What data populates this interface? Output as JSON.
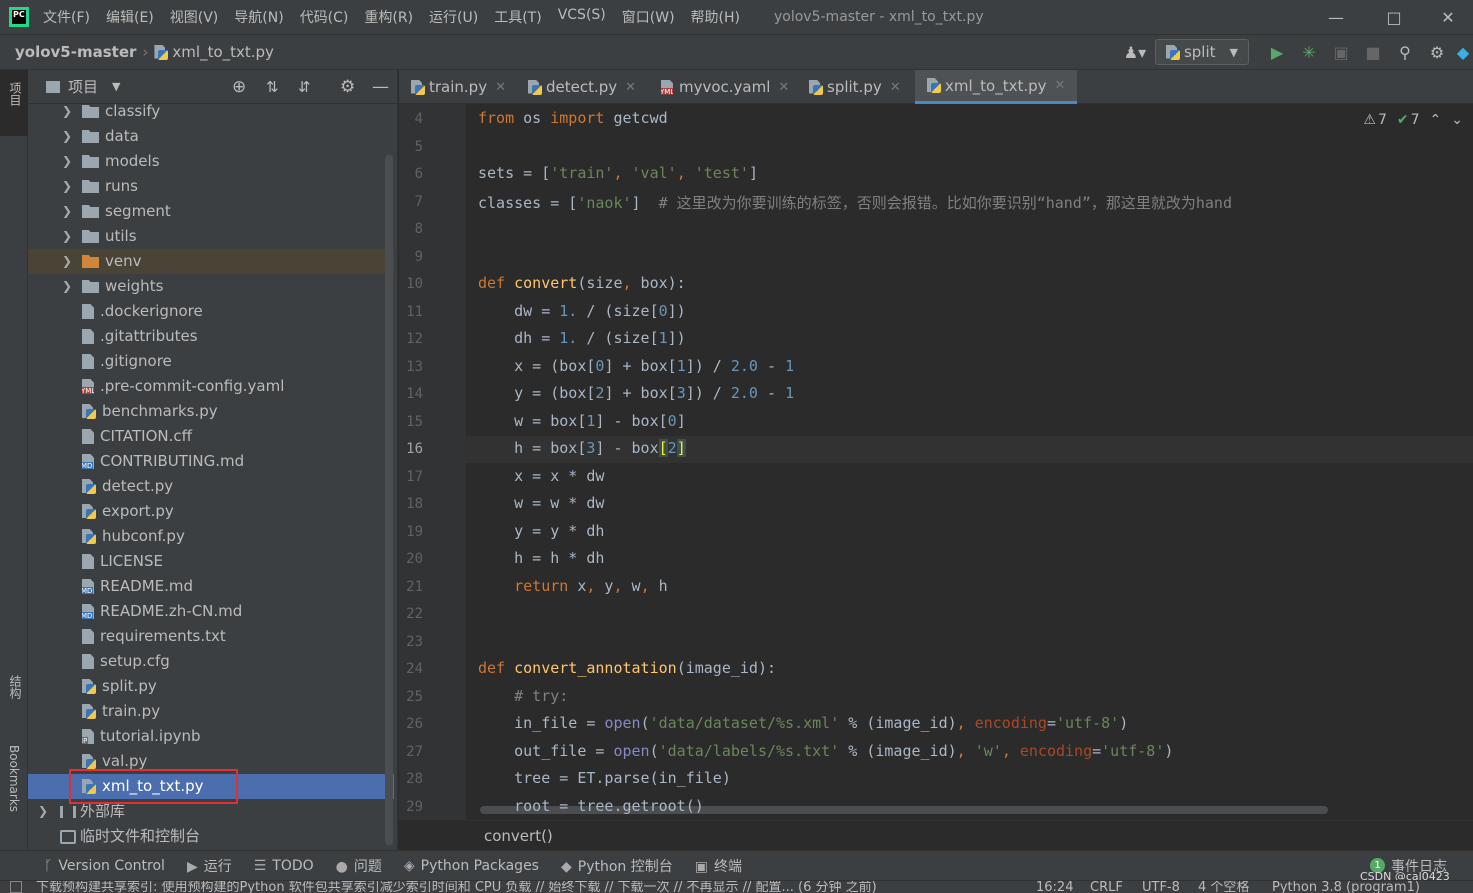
{
  "window": {
    "title": "yolov5-master - xml_to_txt.py"
  },
  "menu": [
    "文件(F)",
    "编辑(E)",
    "视图(V)",
    "导航(N)",
    "代码(C)",
    "重构(R)",
    "运行(U)",
    "工具(T)",
    "VCS(S)",
    "窗口(W)",
    "帮助(H)"
  ],
  "navbar": {
    "project": "yolov5-master",
    "file": "xml_to_txt.py",
    "run_config": "split"
  },
  "left_strip": {
    "project": "项目",
    "structure": "结构",
    "bookmarks": "Bookmarks"
  },
  "project_panel": {
    "title": "项目",
    "tree": [
      {
        "name": "classify",
        "type": "folder"
      },
      {
        "name": "data",
        "type": "folder"
      },
      {
        "name": "models",
        "type": "folder"
      },
      {
        "name": "runs",
        "type": "folder"
      },
      {
        "name": "segment",
        "type": "folder"
      },
      {
        "name": "utils",
        "type": "folder"
      },
      {
        "name": "venv",
        "type": "folder-orange"
      },
      {
        "name": "weights",
        "type": "folder"
      },
      {
        "name": ".dockerignore",
        "type": "file"
      },
      {
        "name": ".gitattributes",
        "type": "file"
      },
      {
        "name": ".gitignore",
        "type": "file"
      },
      {
        "name": ".pre-commit-config.yaml",
        "type": "yaml"
      },
      {
        "name": "benchmarks.py",
        "type": "py"
      },
      {
        "name": "CITATION.cff",
        "type": "file"
      },
      {
        "name": "CONTRIBUTING.md",
        "type": "md"
      },
      {
        "name": "detect.py",
        "type": "py"
      },
      {
        "name": "export.py",
        "type": "py"
      },
      {
        "name": "hubconf.py",
        "type": "py"
      },
      {
        "name": "LICENSE",
        "type": "file"
      },
      {
        "name": "README.md",
        "type": "md"
      },
      {
        "name": "README.zh-CN.md",
        "type": "md"
      },
      {
        "name": "requirements.txt",
        "type": "file"
      },
      {
        "name": "setup.cfg",
        "type": "file"
      },
      {
        "name": "split.py",
        "type": "py"
      },
      {
        "name": "train.py",
        "type": "py"
      },
      {
        "name": "tutorial.ipynb",
        "type": "ipynb"
      },
      {
        "name": "val.py",
        "type": "py"
      },
      {
        "name": "xml_to_txt.py",
        "type": "py"
      }
    ],
    "external_libs": "外部库",
    "scratches": "临时文件和控制台"
  },
  "editor_tabs": [
    {
      "label": "train.py",
      "type": "py"
    },
    {
      "label": "detect.py",
      "type": "py"
    },
    {
      "label": "myvoc.yaml",
      "type": "yaml"
    },
    {
      "label": "split.py",
      "type": "py"
    },
    {
      "label": "xml_to_txt.py",
      "type": "py",
      "active": true
    }
  ],
  "inspections": {
    "warnings": "7",
    "ok": "7"
  },
  "code": {
    "current_line": "16",
    "lines": [
      {
        "n": "4",
        "html": "<span class='kw'>from</span> os <span class='kw'>import</span> getcwd"
      },
      {
        "n": "5",
        "html": ""
      },
      {
        "n": "6",
        "html": "sets = [<span class='str'>'train'</span><span class='kw'>,</span> <span class='str'>'val'</span><span class='kw'>,</span> <span class='str'>'test'</span>]"
      },
      {
        "n": "7",
        "html": "classes = [<span class='str'>'naok'</span>]  <span class='cm'># 这里改为你要训练的标签，否则会报错。比如你要识别“hand”，那这里就改为hand</span>"
      },
      {
        "n": "8",
        "html": ""
      },
      {
        "n": "9",
        "html": ""
      },
      {
        "n": "10",
        "html": "<span class='kw'>def</span> <span class='fn'>convert</span>(size<span class='kw'>,</span> box):"
      },
      {
        "n": "11",
        "html": "    dw = <span class='num'>1.</span> / (size[<span class='num'>0</span>])"
      },
      {
        "n": "12",
        "html": "    dh = <span class='num'>1.</span> / (size[<span class='num'>1</span>])"
      },
      {
        "n": "13",
        "html": "    x = (box[<span class='num'>0</span>] + box[<span class='num'>1</span>]) / <span class='num'>2.0</span> - <span class='num'>1</span>"
      },
      {
        "n": "14",
        "html": "    y = (box[<span class='num'>2</span>] + box[<span class='num'>3</span>]) / <span class='num'>2.0</span> - <span class='num'>1</span>"
      },
      {
        "n": "15",
        "html": "    w = box[<span class='num'>1</span>] - box[<span class='num'>0</span>]"
      },
      {
        "n": "16",
        "html": "    h = box[<span class='num'>3</span>] - box<span style='color:#ffef28;background:#3b514d'>[</span><span class='num'>2</span><span style='color:#ffef28;background:#3b514d'>]</span>"
      },
      {
        "n": "17",
        "html": "    x = x * dw"
      },
      {
        "n": "18",
        "html": "    w = w * dw"
      },
      {
        "n": "19",
        "html": "    y = y * dh"
      },
      {
        "n": "20",
        "html": "    h = h * dh"
      },
      {
        "n": "21",
        "html": "    <span class='kw'>return</span> x<span class='kw'>,</span> y<span class='kw'>,</span> w<span class='kw'>,</span> h"
      },
      {
        "n": "22",
        "html": ""
      },
      {
        "n": "23",
        "html": ""
      },
      {
        "n": "24",
        "html": "<span class='kw'>def</span> <span class='fn'>convert_annotation</span>(image_id):"
      },
      {
        "n": "25",
        "html": "    <span class='cm'># try:</span>"
      },
      {
        "n": "26",
        "html": "    in_file = <span style='color:#8888c6'>open</span>(<span class='str'>'data/dataset/%s.xml'</span> % (image_id)<span class='kw'>,</span> <span class='kwa'>encoding</span>=<span class='str'>'utf-8'</span>)"
      },
      {
        "n": "27",
        "html": "    out_file = <span style='color:#8888c6'>open</span>(<span class='str'>'data/labels/%s.txt'</span> % (image_id)<span class='kw'>,</span> <span class='str'>'w'</span><span class='kw'>,</span> <span class='kwa'>encoding</span>=<span class='str'>'utf-8'</span>)"
      },
      {
        "n": "28",
        "html": "    tree = ET.parse(in_file)"
      },
      {
        "n": "29",
        "html": "    root = tree.getroot()"
      }
    ]
  },
  "breadcrumb": "convert()",
  "bottom_tools": [
    {
      "label": "Version Control",
      "icon": "branch-icon",
      "glyph": "ᚴ"
    },
    {
      "label": "运行",
      "icon": "run-icon",
      "glyph": "▶"
    },
    {
      "label": "TODO",
      "icon": "todo-icon",
      "glyph": "☰"
    },
    {
      "label": "问题",
      "icon": "problems-icon",
      "glyph": "●"
    },
    {
      "label": "Python Packages",
      "icon": "packages-icon",
      "glyph": "◈"
    },
    {
      "label": "Python 控制台",
      "icon": "python-console-icon",
      "glyph": "◆"
    },
    {
      "label": "终端",
      "icon": "terminal-icon",
      "glyph": "▣"
    }
  ],
  "event_log": {
    "label": "事件日志",
    "count": "1"
  },
  "watermark": "CSDN @cal0423",
  "statusbar": {
    "message": "下载预构建共享索引: 使用预构建的Python 软件包共享索引减少索引时间和 CPU 负载 // 始终下载 // 下载一次 // 不再显示 // 配置... (6 分钟 之前)",
    "position": "16:24",
    "line_sep": "CRLF",
    "encoding": "UTF-8",
    "indent": "4 个空格",
    "interpreter": "Python 3.8 (program1)"
  }
}
